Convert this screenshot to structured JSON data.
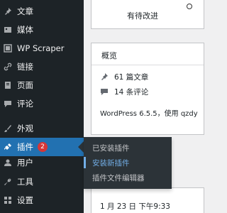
{
  "sidebar": {
    "items": [
      {
        "label": "文章",
        "icon": "pin-icon"
      },
      {
        "label": "媒体",
        "icon": "media-icon"
      },
      {
        "label": "WP Scraper",
        "icon": "scraper-icon"
      },
      {
        "label": "链接",
        "icon": "link-icon"
      },
      {
        "label": "页面",
        "icon": "page-icon"
      },
      {
        "label": "评论",
        "icon": "comment-icon"
      },
      {
        "label": "外观",
        "icon": "brush-icon"
      },
      {
        "label": "插件",
        "icon": "plugin-icon",
        "badge": "2",
        "active": true
      },
      {
        "label": "用户",
        "icon": "user-icon"
      },
      {
        "label": "工具",
        "icon": "wrench-icon"
      },
      {
        "label": "设置",
        "icon": "settings-icon"
      }
    ],
    "submenu": [
      {
        "label": "已安装插件"
      },
      {
        "label": "安装新插件",
        "current": true
      },
      {
        "label": "插件文件编辑器"
      }
    ]
  },
  "main": {
    "top_card": {
      "label": "有待改进"
    },
    "overview": {
      "title": "概览",
      "posts": "61 篇文章",
      "comments": "14 条评论",
      "wp_version": "WordPress 6.5.5，使用 qzdy"
    },
    "bottom_card": {
      "date": "1 月 23 日 下午9:33"
    }
  },
  "colors": {
    "sidebar_bg": "#1d2327",
    "active_bg": "#2271b1",
    "submenu_bg": "#2c3338",
    "badge": "#d63638",
    "link_current": "#72aee6"
  }
}
